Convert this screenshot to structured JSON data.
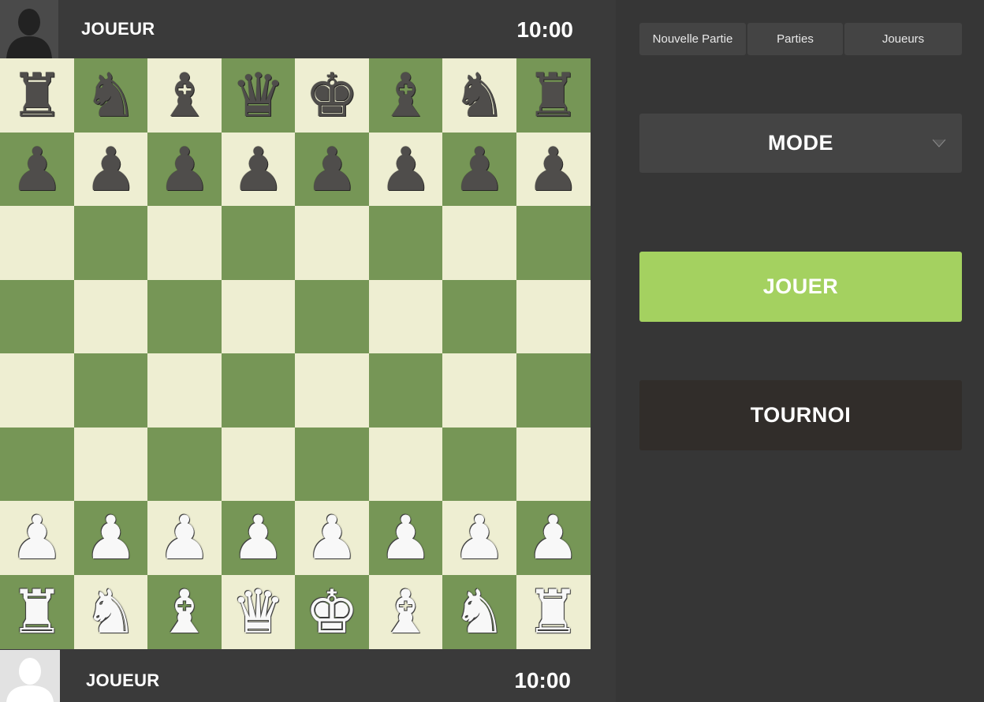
{
  "top_player": {
    "name": "JOUEUR",
    "clock": "10:00",
    "avatar_icon": "dark-silhouette-avatar"
  },
  "bottom_player": {
    "name": "JOUEUR",
    "clock": "10:00",
    "avatar_icon": "light-silhouette-avatar"
  },
  "tabs": [
    {
      "label": "Nouvelle Partie"
    },
    {
      "label": "Parties"
    },
    {
      "label": "Joueurs"
    }
  ],
  "mode": {
    "label": "MODE",
    "icon": "chevron-down-icon"
  },
  "play_button": {
    "label": "JOUER"
  },
  "tournament_button": {
    "label": "TOURNOI"
  },
  "colors": {
    "light_square": "#eeeed2",
    "dark_square": "#769656",
    "play_button": "#a4d160",
    "tournament_button": "#312d2a"
  },
  "board": {
    "rows": [
      [
        "r",
        "n",
        "b",
        "q",
        "k",
        "b",
        "n",
        "r"
      ],
      [
        "p",
        "p",
        "p",
        "p",
        "p",
        "p",
        "p",
        "p"
      ],
      [
        "",
        "",
        "",
        "",
        "",
        "",
        "",
        ""
      ],
      [
        "",
        "",
        "",
        "",
        "",
        "",
        "",
        ""
      ],
      [
        "",
        "",
        "",
        "",
        "",
        "",
        "",
        ""
      ],
      [
        "",
        "",
        "",
        "",
        "",
        "",
        "",
        ""
      ],
      [
        "P",
        "P",
        "P",
        "P",
        "P",
        "P",
        "P",
        "P"
      ],
      [
        "R",
        "N",
        "B",
        "Q",
        "K",
        "B",
        "N",
        "R"
      ]
    ]
  }
}
